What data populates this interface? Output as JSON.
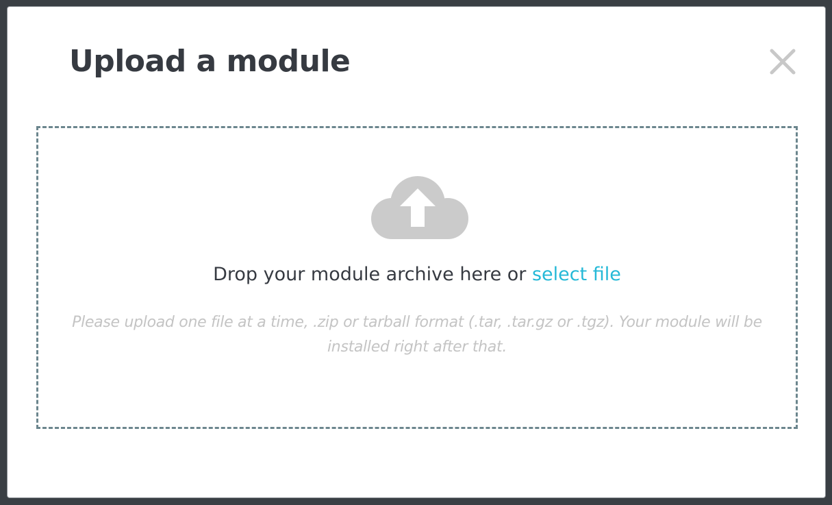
{
  "modal": {
    "title": "Upload a module",
    "close_icon": "close-icon"
  },
  "dropzone": {
    "icon": "cloud-upload-icon",
    "drop_text": "Drop your module archive here or",
    "select_link": "select file",
    "help_text": "Please upload one file at a time, .zip or tarball format (.tar, .tar.gz or .tgz). Your module will be installed right after that."
  },
  "colors": {
    "title": "#363a41",
    "link": "#25b9d7",
    "dashed_border": "#6c868e",
    "icon": "#cbcbcb",
    "help_text": "#c4c4c4"
  }
}
